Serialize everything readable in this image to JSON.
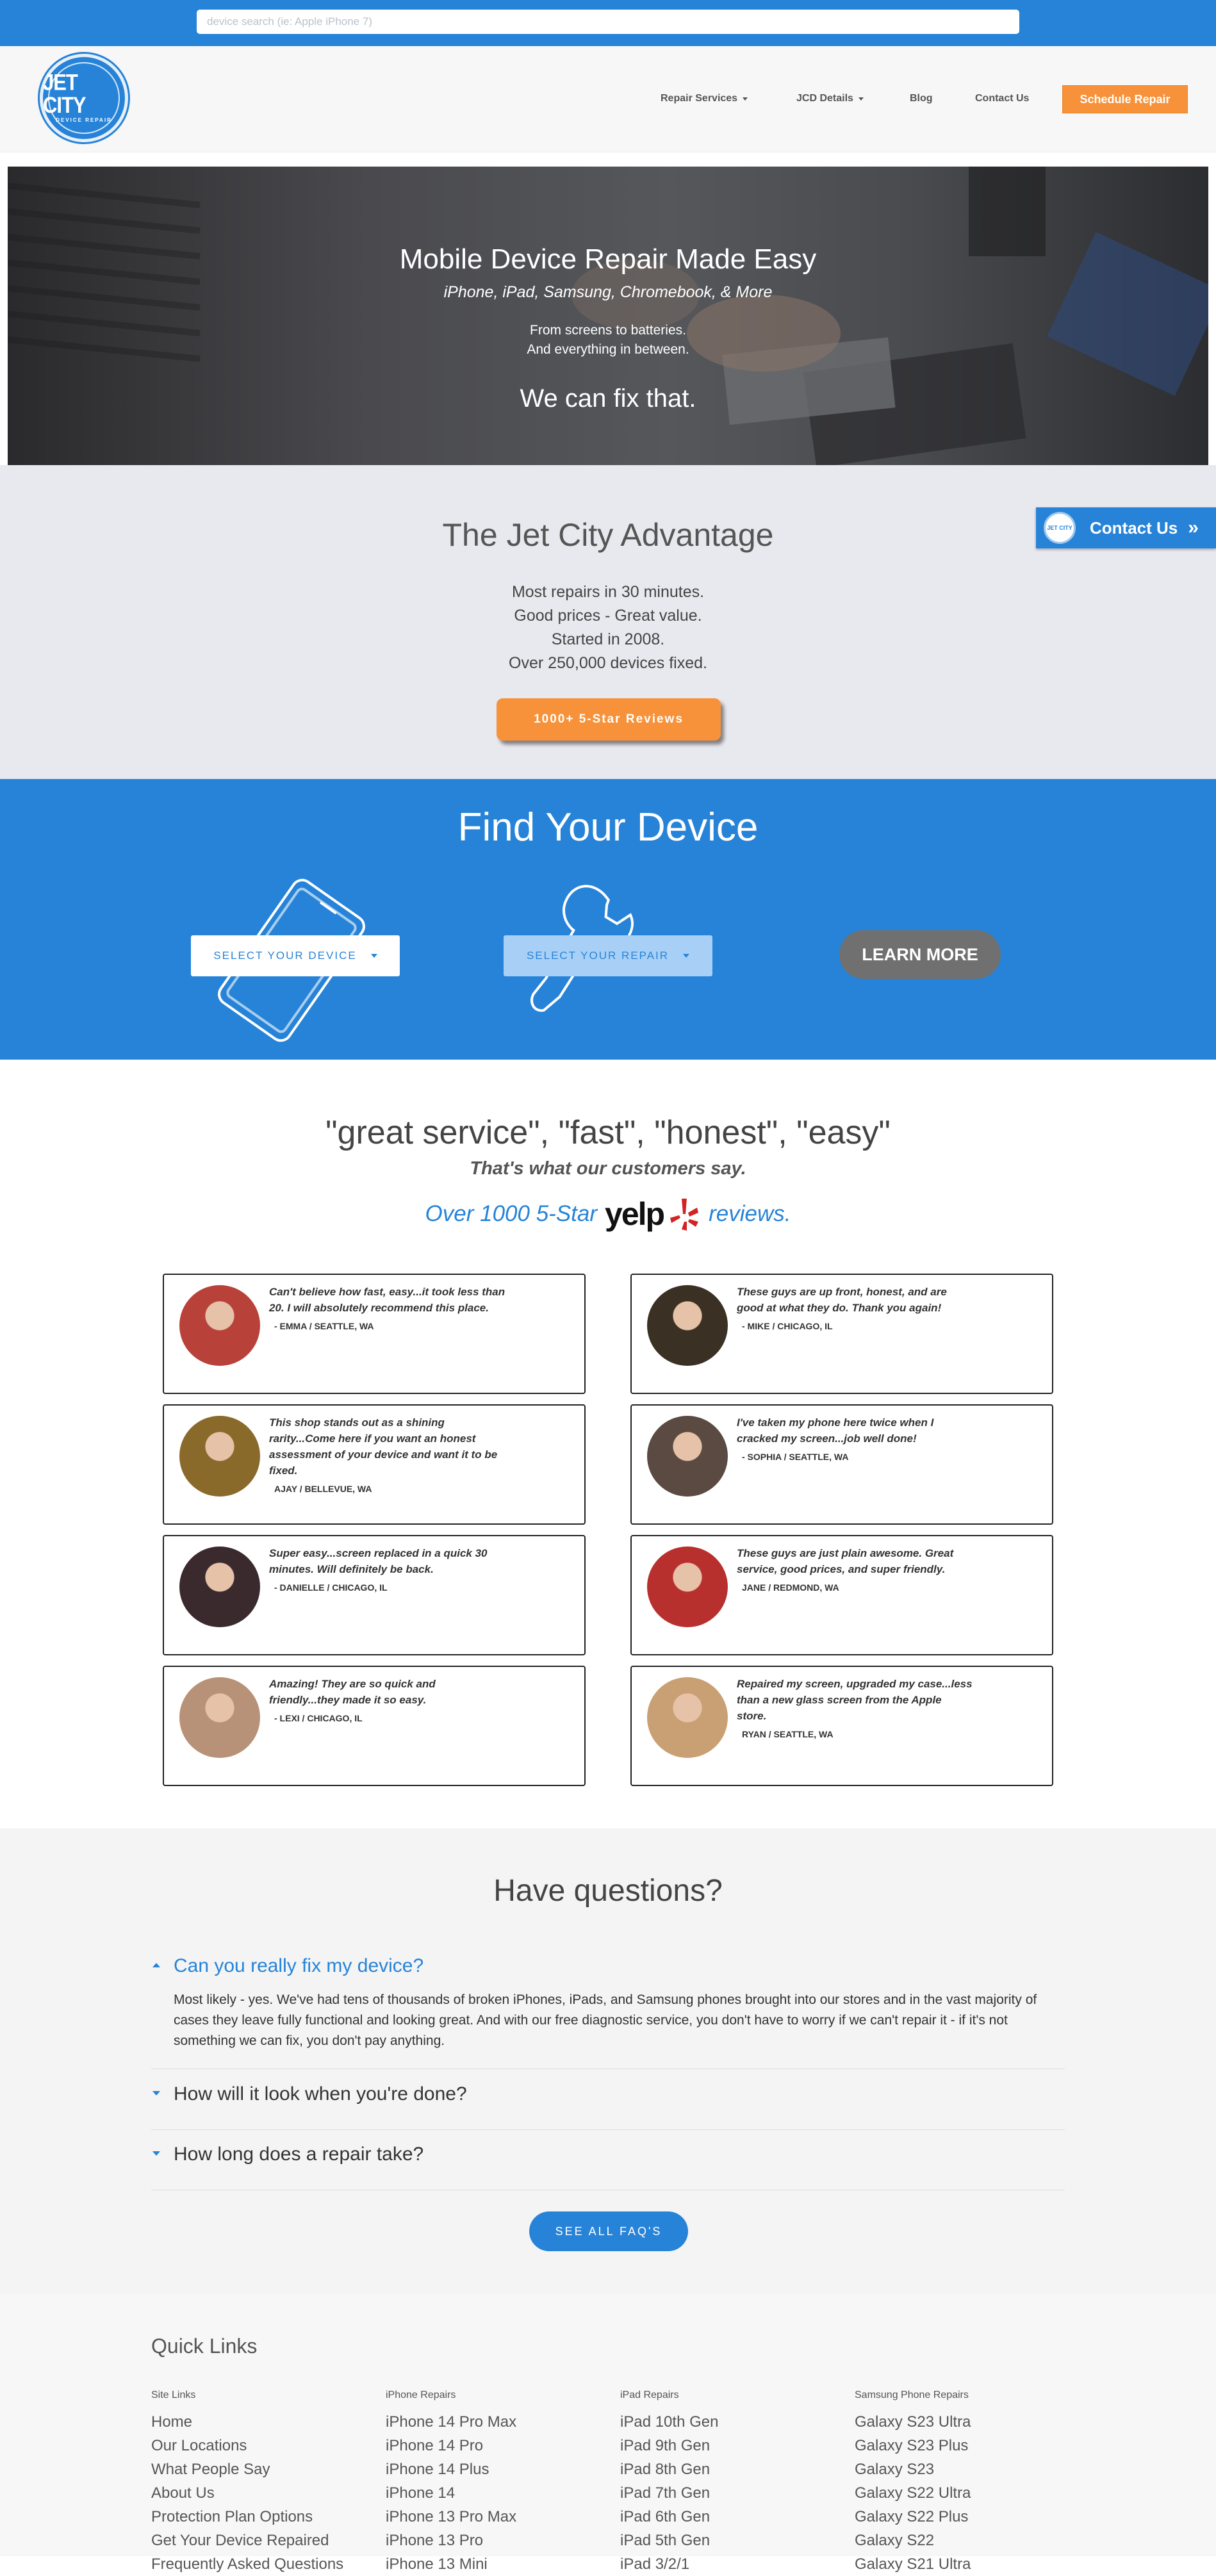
{
  "search": {
    "placeholder": "device search (ie: Apple iPhone 7)"
  },
  "logo": {
    "main": "JET CITY",
    "sub": "DEVICE REPAIR"
  },
  "nav": {
    "repair_services": "Repair Services",
    "jcd_details": "JCD Details",
    "blog": "Blog",
    "contact": "Contact Us",
    "schedule": "Schedule Repair"
  },
  "hero": {
    "title": "Mobile Device Repair Made Easy",
    "subtitle": "iPhone, iPad, Samsung, Chromebook, & More",
    "line1": "From screens to batteries.",
    "line2": "And everything in between.",
    "tagline": "We can fix that."
  },
  "advantage": {
    "title": "The Jet City Advantage",
    "points": [
      "Most repairs in 30 minutes.",
      "Good prices - Great value.",
      "Started in 2008.",
      "Over 250,000 devices fixed."
    ],
    "button": "1000+ 5-Star Reviews"
  },
  "contact_tab": {
    "label": "Contact Us",
    "icon_text": "JET CITY"
  },
  "find": {
    "title": "Find Your Device",
    "select_device": "SELECT YOUR DEVICE",
    "select_repair": "SELECT YOUR REPAIR",
    "learn_more": "LEARN MORE"
  },
  "testimonials": {
    "heading": "\"great service\", \"fast\", \"honest\", \"easy\"",
    "subheading": "That's what our customers say.",
    "yelp_prefix": "Over 1000 5-Star",
    "yelp_logo": "yelp",
    "yelp_suffix": "reviews.",
    "items": [
      {
        "quote": "Can't believe how fast, easy...it took less than 20. I will absolutely recommend this place.",
        "author": "- EMMA / SEATTLE, WA",
        "color": "#b8423a"
      },
      {
        "quote": "These guys are up front, honest, and are good at what they do. Thank you again!",
        "author": "- MIKE / CHICAGO, IL",
        "color": "#3b3024"
      },
      {
        "quote": "This shop stands out as a shining rarity...Come here if you want an honest assessment of your device and want it to be fixed.",
        "author": "AJAY / BELLEVUE, WA",
        "color": "#8a6a2a"
      },
      {
        "quote": "I've taken my phone here twice when I cracked my screen...job well done!",
        "author": "- SOPHIA / SEATTLE, WA",
        "color": "#5a4a42"
      },
      {
        "quote": "Super easy...screen replaced in a quick 30 minutes. Will definitely be back.",
        "author": "- DANIELLE / CHICAGO, IL",
        "color": "#3a2a2e"
      },
      {
        "quote": "These guys are just plain awesome. Great service, good prices, and super friendly.",
        "author": "JANE / REDMOND, WA",
        "color": "#b8302e"
      },
      {
        "quote": "Amazing! They are so quick and friendly...they made it so easy.",
        "author": "- LEXI / CHICAGO, IL",
        "color": "#b89278"
      },
      {
        "quote": "Repaired my screen, upgraded my case...less than a new glass screen from the Apple store.",
        "author": "RYAN / SEATTLE, WA",
        "color": "#c9a074"
      }
    ]
  },
  "faq": {
    "title": "Have questions?",
    "q1": "Can you really fix my device?",
    "a1": "Most likely - yes. We've had tens of thousands of broken iPhones, iPads, and Samsung phones brought into our stores and in the vast majority of cases they leave fully functional and looking great. And with our free diagnostic service, you don't have to worry if we can't repair it - if it's not something we can fix, you don't pay anything.",
    "q2": "How will it look when you're done?",
    "q3": "How long does a repair take?",
    "button": "SEE ALL FAQ'S"
  },
  "footer": {
    "title": "Quick Links",
    "columns": [
      {
        "head": "Site Links",
        "links": [
          "Home",
          "Our Locations",
          "What People Say",
          "About Us",
          "Protection Plan Options",
          "Get Your Device Repaired",
          "Frequently Asked Questions"
        ]
      },
      {
        "head": "iPhone Repairs",
        "links": [
          "iPhone 14 Pro Max",
          "iPhone 14 Pro",
          "iPhone 14 Plus",
          "iPhone 14",
          "iPhone 13 Pro Max",
          "iPhone 13 Pro",
          "iPhone 13 Mini"
        ]
      },
      {
        "head": "iPad Repairs",
        "links": [
          "iPad 10th Gen",
          "iPad 9th Gen",
          "iPad 8th Gen",
          "iPad 7th Gen",
          "iPad 6th Gen",
          "iPad 5th Gen",
          "iPad 3/2/1"
        ]
      },
      {
        "head": "Samsung Phone Repairs",
        "links": [
          "Galaxy S23 Ultra",
          "Galaxy S23 Plus",
          "Galaxy S23",
          "Galaxy S22 Ultra",
          "Galaxy S22 Plus",
          "Galaxy S22",
          "Galaxy S21 Ultra"
        ]
      }
    ]
  },
  "colors": {
    "brand_blue": "#2683d8",
    "accent_orange": "#f7923a",
    "yelp_red": "#d32323"
  }
}
